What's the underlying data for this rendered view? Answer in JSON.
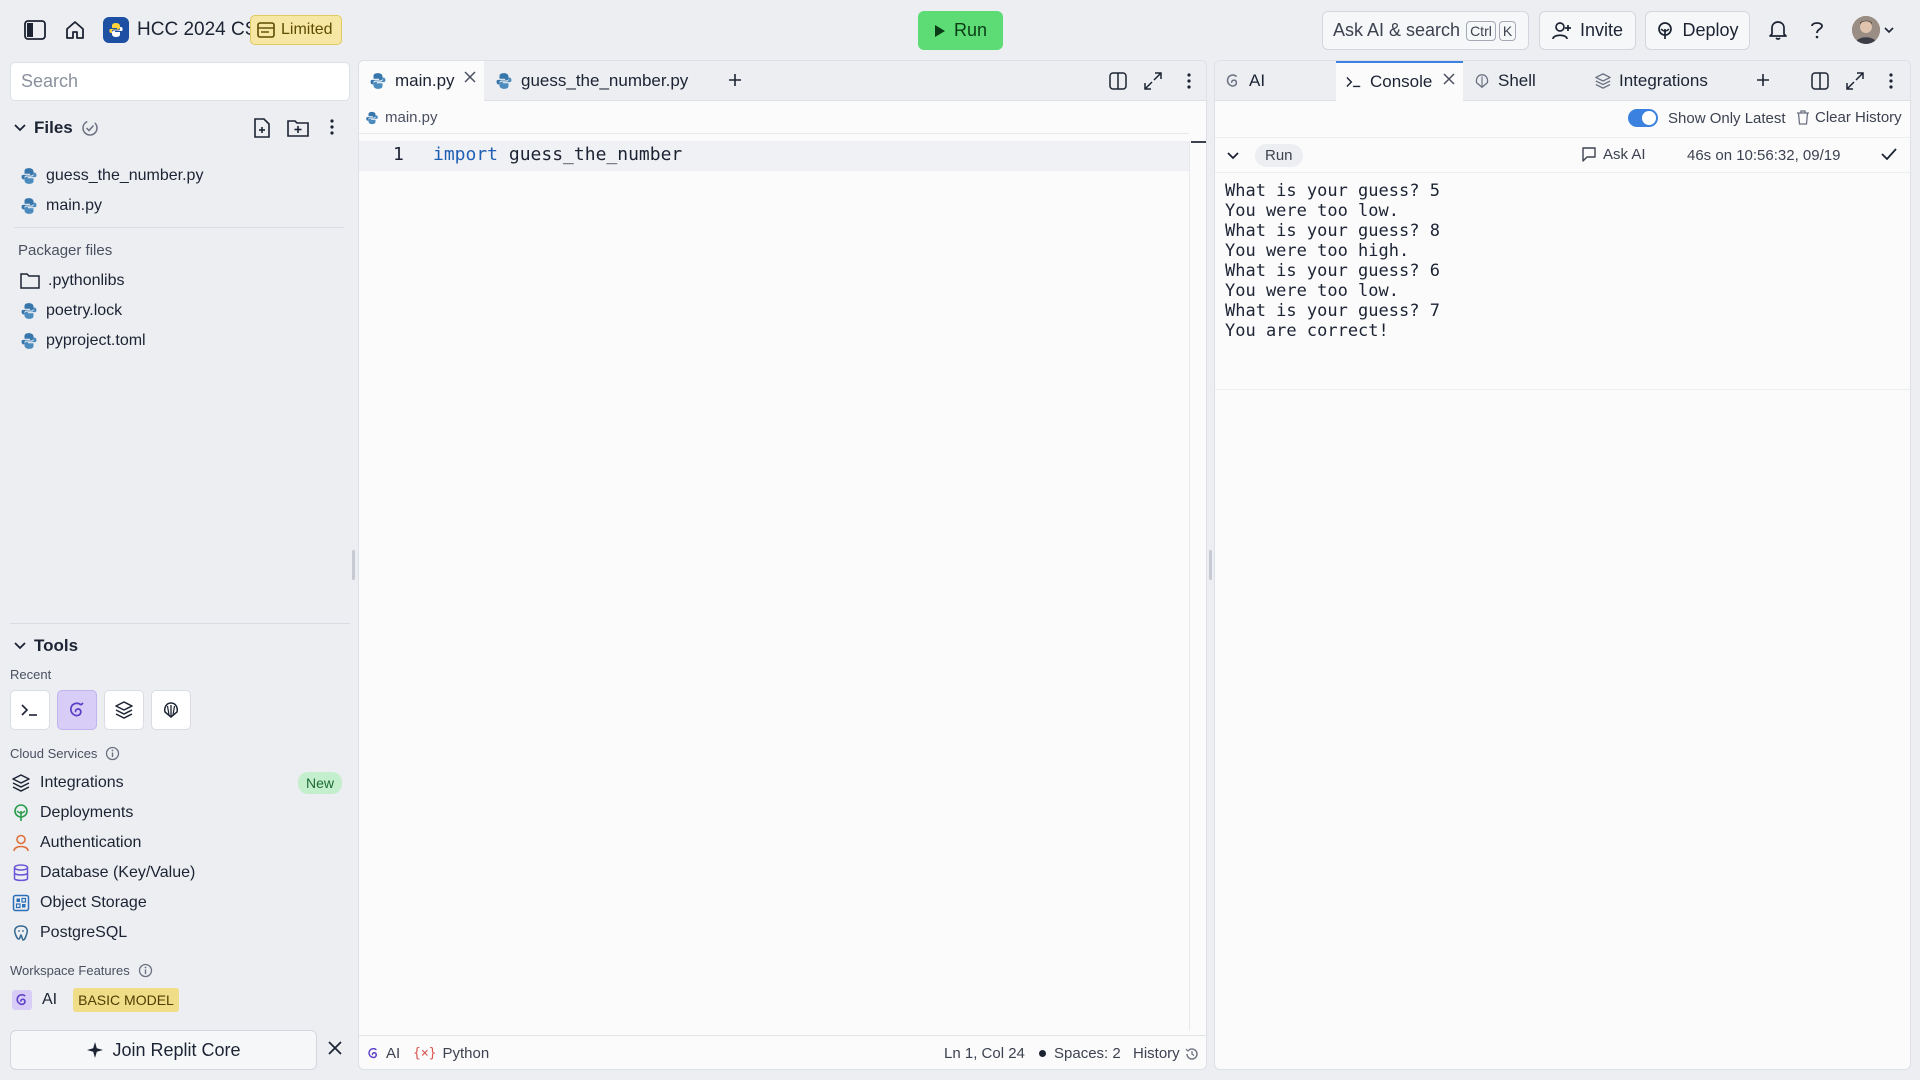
{
  "topbar": {
    "project_name": "HCC 2024 CS",
    "limited_label": "Limited",
    "run_label": "Run",
    "search_label": "Ask AI & search",
    "shortcut_ctrl": "Ctrl",
    "shortcut_k": "K",
    "invite_label": "Invite",
    "deploy_label": "Deploy"
  },
  "sidebar": {
    "search_placeholder": "Search",
    "files_heading": "Files",
    "files": [
      {
        "name": "guess_the_number.py",
        "icon": "python-icon"
      },
      {
        "name": "main.py",
        "icon": "python-icon"
      }
    ],
    "packager_heading": "Packager files",
    "packager_files": [
      {
        "name": ".pythonlibs",
        "icon": "folder-icon"
      },
      {
        "name": "poetry.lock",
        "icon": "python-icon"
      },
      {
        "name": "pyproject.toml",
        "icon": "python-icon"
      }
    ],
    "tools_heading": "Tools",
    "recent_label": "Recent",
    "cloud_services_label": "Cloud Services",
    "cloud_services": [
      {
        "name": "Integrations",
        "badge": "New"
      },
      {
        "name": "Deployments"
      },
      {
        "name": "Authentication"
      },
      {
        "name": "Database (Key/Value)"
      },
      {
        "name": "Object Storage"
      },
      {
        "name": "PostgreSQL"
      }
    ],
    "workspace_features_label": "Workspace Features",
    "ai_label": "AI",
    "ai_badge": "BASIC MODEL",
    "join_label": "Join Replit Core"
  },
  "editor": {
    "tabs": [
      {
        "label": "main.py",
        "active": true
      },
      {
        "label": "guess_the_number.py",
        "active": false
      }
    ],
    "breadcrumb": "main.py",
    "line_number": "1",
    "code_keyword": "import",
    "code_rest": " guess_the_number",
    "status": {
      "ai": "AI",
      "language": "Python",
      "position": "Ln 1, Col 24",
      "spaces": "Spaces: 2",
      "history": "History"
    }
  },
  "right_panel": {
    "tabs": [
      {
        "label": "AI"
      },
      {
        "label": "Console",
        "active": true
      },
      {
        "label": "Shell"
      },
      {
        "label": "Integrations"
      }
    ],
    "show_only_latest": "Show Only Latest",
    "clear_history": "Clear History",
    "run_chip": "Run",
    "ask_ai": "Ask AI",
    "run_time": "46s on 10:56:32, 09/19",
    "console_lines": [
      "What is your guess? 5",
      "You were too low.",
      "What is your guess? 8",
      "You were too high.",
      "What is your guess? 6",
      "You were too low.",
      "What is your guess? 7",
      "You are correct!"
    ]
  },
  "colors": {
    "run_button": "#5ddc76",
    "limited_badge": "#f6e7a4",
    "new_badge": "#c4efcc",
    "basic_badge": "#f0dd87",
    "toggle_on": "#3b82e0"
  }
}
